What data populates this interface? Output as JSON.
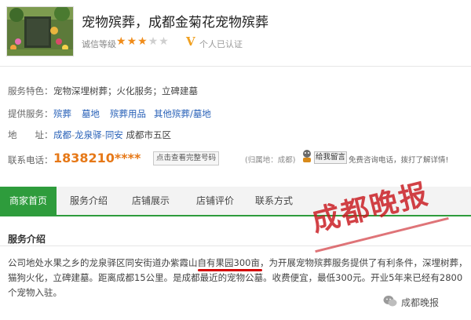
{
  "header": {
    "title": "宠物殡葬，成都金菊花宠物殡葬",
    "rating_label": "诚信等级",
    "stars": {
      "filled": 3,
      "total": 5
    },
    "verify_mark": "V",
    "verify_text": "个人已认证"
  },
  "info": {
    "features_label": "服务特色：",
    "features_value": "宠物深埋树葬；火化服务；立碑建墓",
    "services_label": "提供服务：",
    "services": [
      "殡葬",
      "墓地",
      "殡葬用品",
      "其他殡葬/墓地"
    ],
    "address_label": "地　　址：",
    "address_parts": [
      "成都",
      "-",
      "龙泉驿",
      "-",
      "同安",
      "成都市五区"
    ],
    "phone_label": "联系电话：",
    "phone_value": "1838210****",
    "phone_button": "点击查看完整号码",
    "location_hint": "(归属地：成都)",
    "message_button": "给我留言",
    "message_hint": "免费咨询电话，拨打了解详情!"
  },
  "nav": {
    "tabs": [
      "商家首页",
      "服务介绍",
      "店铺展示",
      "店铺评价",
      "联系方式"
    ],
    "active_index": 0
  },
  "section": {
    "title": "服务介绍",
    "desc_part1": "公司地处水果之乡的龙泉驿区同安街道办紫霞山",
    "desc_highlight": "自有果园300亩",
    "desc_part2": "，为开展宠物殡葬服务提供了有利条件，深埋树葬，猫狗火化，立碑建墓。距离成都15公里。是成都最近的宠物公墓。收费便宜，最低300元。开业5年来已经有2800个宠物入驻。"
  },
  "watermark": {
    "text": "成都晚报"
  },
  "footer": {
    "wechat_label": "成都晚报"
  },
  "colors": {
    "accent_green": "#2e9c3c",
    "phone_orange": "#e67817",
    "star_orange": "#f08c1a",
    "link_blue": "#2a62b8",
    "watermark_red": "#c9181e"
  }
}
